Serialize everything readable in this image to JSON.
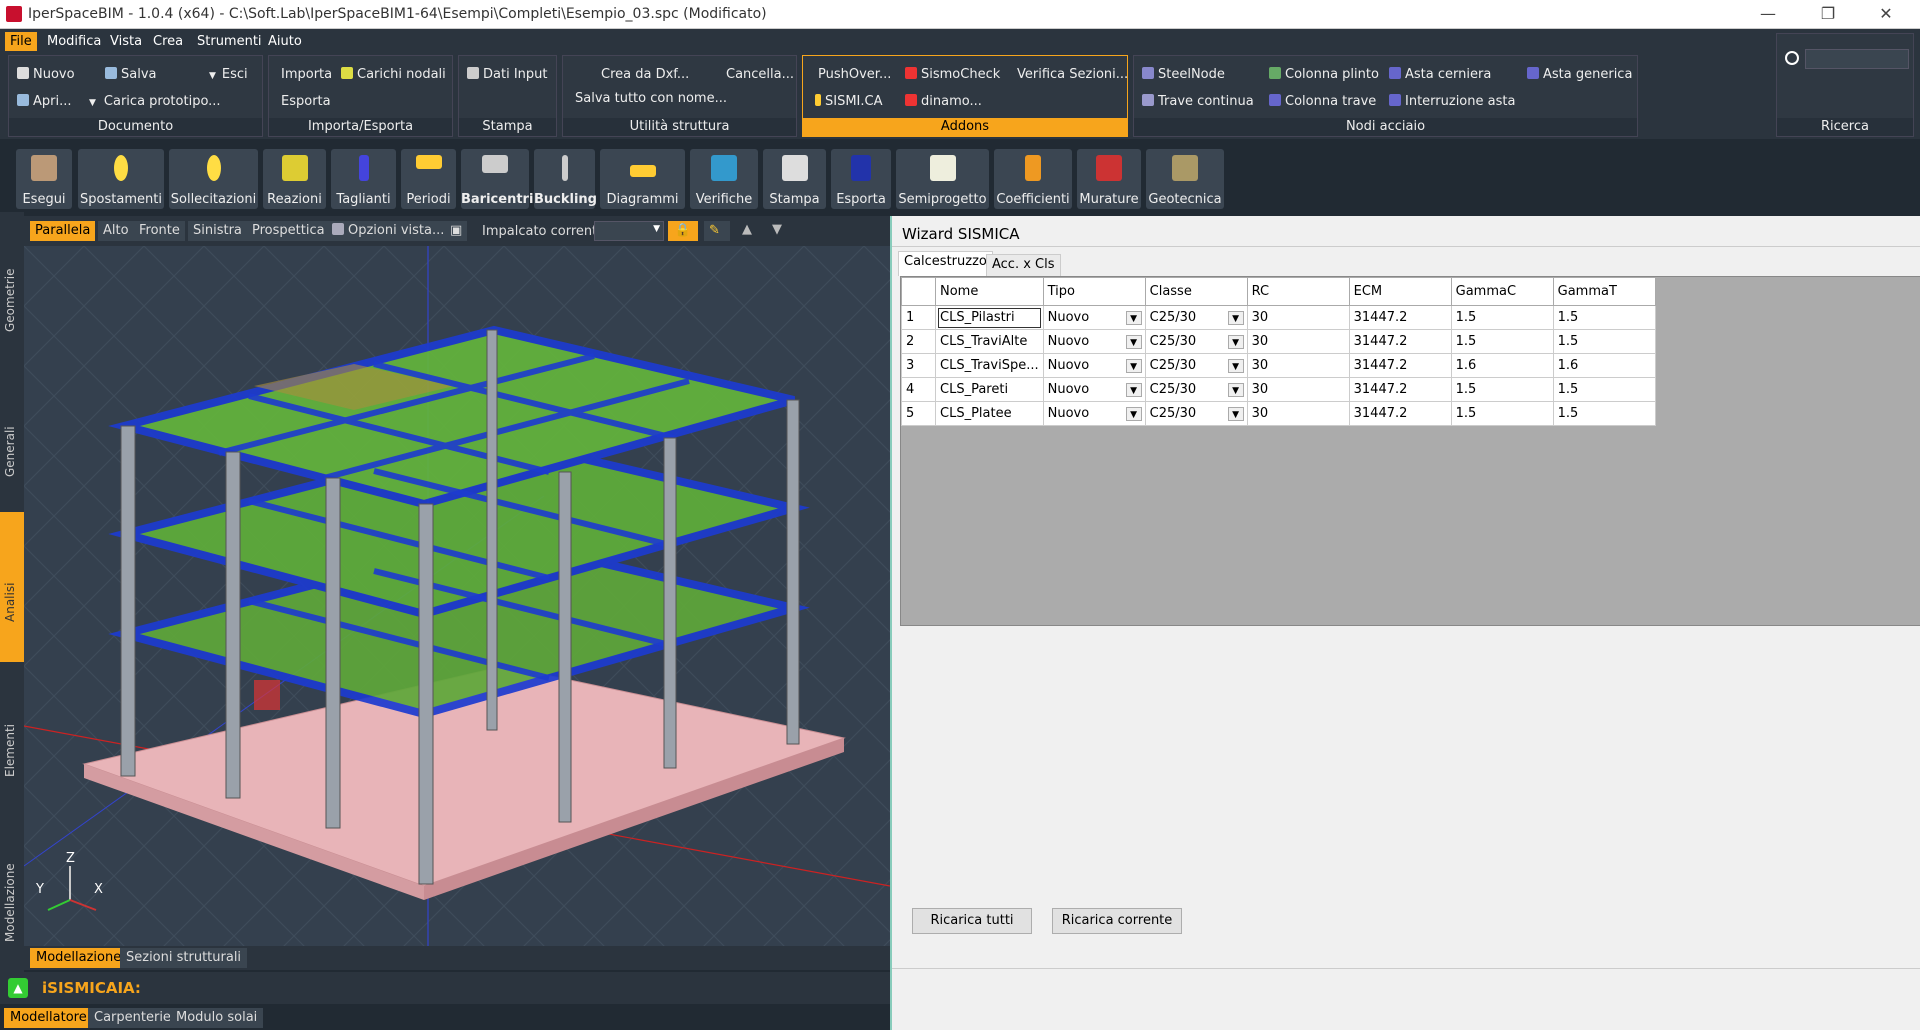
{
  "window": {
    "title": "IperSpaceBIM - 1.0.4 (x64) - C:\\Soft.Lab\\IperSpaceBIM1-64\\Esempi\\Completi\\Esempio_03.spc (Modificato)",
    "minimize": "—",
    "restore": "❐",
    "close": "✕"
  },
  "menu": [
    "File",
    "Modifica",
    "Vista",
    "Crea",
    "Strumenti",
    "Aiuto"
  ],
  "ribbon": {
    "documento": {
      "label": "Documento",
      "nuovo": "Nuovo",
      "salva": "Salva",
      "esci": "Esci",
      "apri": "Apri...",
      "carica": "Carica prototipo..."
    },
    "importa": {
      "label": "Importa/Esporta",
      "importa": "Importa",
      "carichi": "Carichi nodali",
      "esporta": "Esporta"
    },
    "stampa": {
      "label": "Stampa",
      "dati": "Dati Input"
    },
    "utilita": {
      "label": "Utilità struttura",
      "crea_dxf": "Crea da Dxf...",
      "cancella": "Cancella...",
      "salva_tutto": "Salva tutto con nome..."
    },
    "addons": {
      "label": "Addons",
      "pushover": "PushOver...",
      "sismocheck": "SismoCheck",
      "verifica": "Verifica Sezioni...",
      "sismica": "SISMI.CA",
      "dinamo": "dinamo..."
    },
    "nodi": {
      "label": "Nodi acciaio",
      "steelnode": "SteelNode",
      "colonna_plinto": "Colonna plinto",
      "asta_cerniera": "Asta cerniera",
      "asta_generica": "Asta generica",
      "trave_continua": "Trave continua",
      "colonna_trave": "Colonna trave",
      "interruzione": "Interruzione asta"
    },
    "ricerca": {
      "label": "Ricerca"
    }
  },
  "toolbar": [
    "Esegui",
    "Spostamenti",
    "Sollecitazioni",
    "Reazioni",
    "Taglianti",
    "Periodi",
    "Baricentri",
    "Buckling",
    "Diagrammi",
    "Verifiche",
    "Stampa",
    "Esporta",
    "Semiprogetto",
    "Coefficienti",
    "Murature",
    "Geotecnica"
  ],
  "sidetabs": [
    "Geometrie",
    "Generali",
    "Analisi",
    "Elementi",
    "Modellazione"
  ],
  "viewbar": {
    "views": [
      "Parallela",
      "Alto",
      "Fronte",
      "Sinistra",
      "Prospettica"
    ],
    "opzioni": "Opzioni vista...",
    "impalcato": "Impalcato corrente:"
  },
  "axes": {
    "z": "Z",
    "y": "Y",
    "x": "X"
  },
  "viewtabs": [
    "Modellazione",
    "Sezioni strutturali"
  ],
  "cmd": "iSISMICAIA:",
  "bottomtabs": [
    "Modellatore",
    "Carpenterie",
    "Modulo solai"
  ],
  "wizard": {
    "title": "Wizard SISMICA",
    "tabs": [
      "Calcestruzzo",
      "Acc. x Cls"
    ],
    "columns": [
      "Nome",
      "Tipo",
      "Classe",
      "RC",
      "ECM",
      "GammaC",
      "GammaT"
    ],
    "rows": [
      {
        "n": "1",
        "nome": "CLS_Pilastri",
        "tipo": "Nuovo",
        "classe": "C25/30",
        "rc": "30",
        "ecm": "31447.2",
        "gc": "1.5",
        "gt": "1.5"
      },
      {
        "n": "2",
        "nome": "CLS_TraviAlte",
        "tipo": "Nuovo",
        "classe": "C25/30",
        "rc": "30",
        "ecm": "31447.2",
        "gc": "1.5",
        "gt": "1.5"
      },
      {
        "n": "3",
        "nome": "CLS_TraviSpe...",
        "tipo": "Nuovo",
        "classe": "C25/30",
        "rc": "30",
        "ecm": "31447.2",
        "gc": "1.6",
        "gt": "1.6"
      },
      {
        "n": "4",
        "nome": "CLS_Pareti",
        "tipo": "Nuovo",
        "classe": "C25/30",
        "rc": "30",
        "ecm": "31447.2",
        "gc": "1.5",
        "gt": "1.5"
      },
      {
        "n": "5",
        "nome": "CLS_Platee",
        "tipo": "Nuovo",
        "classe": "C25/30",
        "rc": "30",
        "ecm": "31447.2",
        "gc": "1.5",
        "gt": "1.5"
      }
    ],
    "btn_all": "Ricarica tutti",
    "btn_cur": "Ricarica corrente"
  }
}
